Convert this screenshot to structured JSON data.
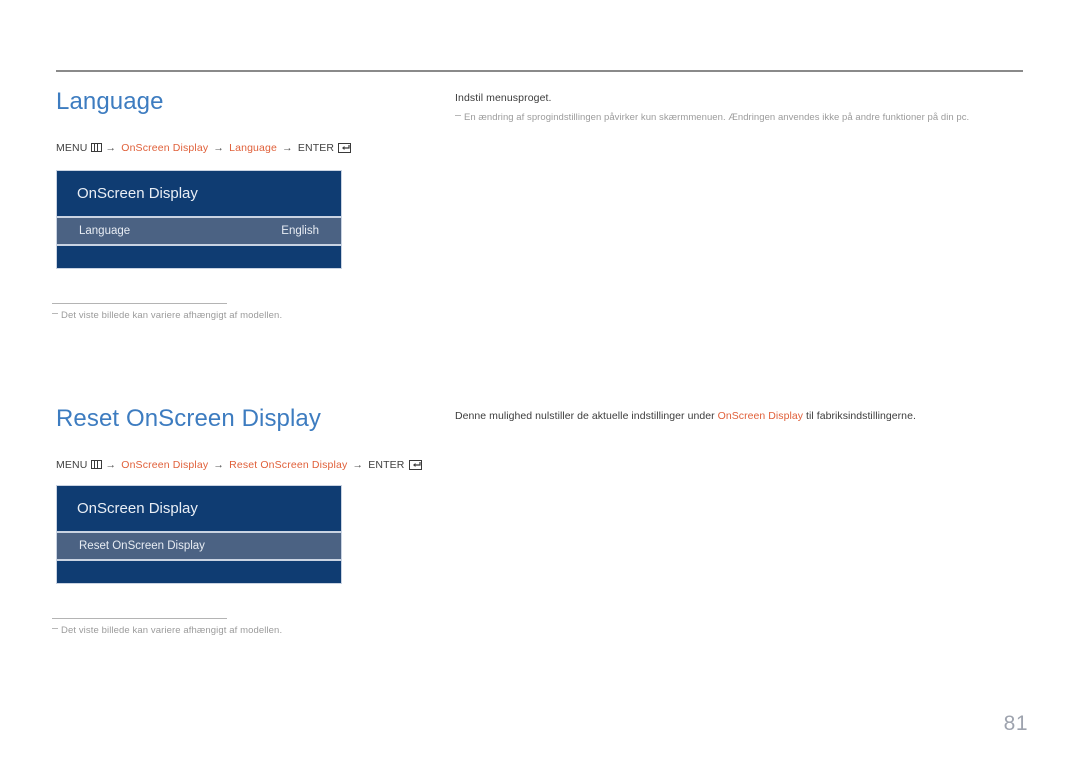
{
  "page": {
    "number": "81"
  },
  "icons": {
    "menu": "menu-bars-icon",
    "enter": "enter-return-icon"
  },
  "sections": [
    {
      "heading": "Language",
      "breadcrumb": {
        "menu_label": "MENU",
        "arrow": "→",
        "path_1": "OnScreen Display",
        "path_2": "Language",
        "enter_label": "ENTER"
      },
      "osd": {
        "title": "OnScreen Display",
        "rows": [
          {
            "label": "Language",
            "value": "English",
            "selected": true
          }
        ]
      },
      "note": "Det viste billede kan variere afhængigt af modellen.",
      "description": {
        "title": "Indstil menusproget.",
        "note": "En ændring af sprogindstillingen påvirker kun skærmmenuen. Ændringen anvendes ikke på andre funktioner på din pc."
      }
    },
    {
      "heading": "Reset OnScreen Display",
      "breadcrumb": {
        "menu_label": "MENU",
        "arrow": "→",
        "path_1": "OnScreen Display",
        "path_2": "Reset OnScreen Display",
        "enter_label": "ENTER"
      },
      "osd": {
        "title": "OnScreen Display",
        "rows": [
          {
            "label": "Reset OnScreen Display",
            "value": "",
            "selected": true
          }
        ]
      },
      "note": "Det viste billede kan variere afhængigt af modellen.",
      "description": {
        "line_pre": "Denne mulighed nulstiller de aktuelle indstillinger under ",
        "line_hl": "OnScreen Display",
        "line_post": " til fabriksindstillingerne."
      }
    }
  ],
  "colors": {
    "heading": "#3d7cc0",
    "accent": "#e0603a",
    "osd_header": "#0f3c72",
    "osd_selected": "#4b6283",
    "note": "#9b9b9b"
  }
}
